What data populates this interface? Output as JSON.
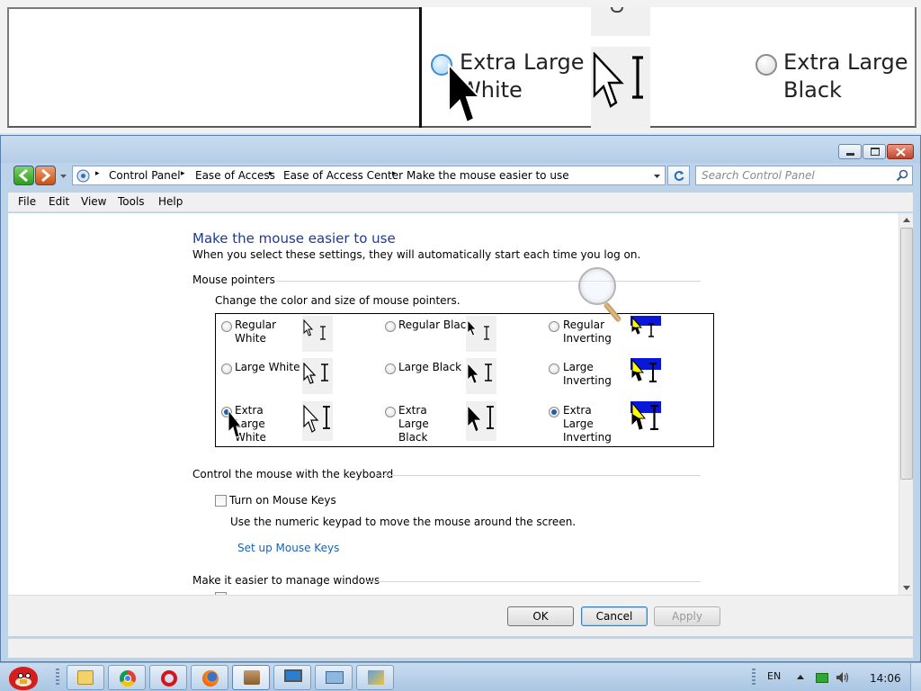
{
  "magnifier": {
    "option_left_label": "Extra Large White",
    "option_right_label": "Extra Large Black"
  },
  "window": {
    "address": {
      "crumbs": [
        "Control Panel",
        "Ease of Access",
        "Ease of Access Center",
        "Make the mouse easier to use"
      ]
    },
    "search": {
      "placeholder": "Search Control Panel"
    },
    "menu": [
      "File",
      "Edit",
      "View",
      "Tools",
      "Help"
    ]
  },
  "page": {
    "title": "Make the mouse easier to use",
    "subtitle": "When you select these settings, they will automatically start each time you log on.",
    "pointers": {
      "heading": "Mouse pointers",
      "description": "Change the color and size of mouse pointers.",
      "options": [
        {
          "label": "Regular White",
          "selected": false
        },
        {
          "label": "Regular Black",
          "selected": false
        },
        {
          "label": "Regular Inverting",
          "selected": false
        },
        {
          "label": "Large White",
          "selected": false
        },
        {
          "label": "Large Black",
          "selected": false
        },
        {
          "label": "Large Inverting",
          "selected": false
        },
        {
          "label": "Extra Large White",
          "selected": true
        },
        {
          "label": "Extra Large Black",
          "selected": false
        },
        {
          "label": "Extra Large Inverting",
          "selected": true
        }
      ]
    },
    "keyboard": {
      "heading": "Control the mouse with the keyboard",
      "mouse_keys_label": "Turn on Mouse Keys",
      "mouse_keys_checked": false,
      "mouse_keys_description": "Use the numeric keypad to move the mouse around the screen.",
      "setup_link": "Set up Mouse Keys"
    },
    "windows": {
      "heading": "Make it easier to manage windows"
    }
  },
  "buttons": {
    "ok": "OK",
    "cancel": "Cancel",
    "apply": "Apply"
  },
  "taskbar": {
    "language": "EN",
    "clock": "14:06",
    "icons": [
      "angry-birds-icon",
      "explorer-icon",
      "chrome-icon",
      "opera-icon",
      "firefox-icon",
      "app-icon",
      "monitor-icon",
      "network-icon",
      "settings-icon"
    ]
  },
  "colors": {
    "title_blue": "#1e3b8c",
    "link_blue": "#1a64b0",
    "inverting_blue": "#0a16d8"
  }
}
